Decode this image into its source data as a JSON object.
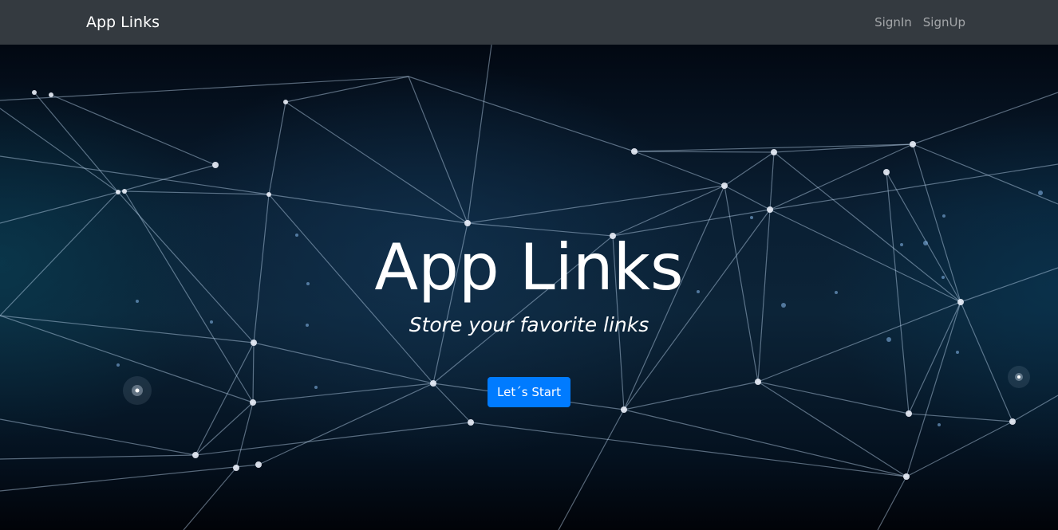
{
  "navbar": {
    "brand": "App Links",
    "links": [
      "SignIn",
      "SignUp"
    ]
  },
  "hero": {
    "title": "App Links",
    "subtitle": "Store your favorite links",
    "button_label": "Let´s Start",
    "background": "plexus-network-image"
  },
  "colors": {
    "navbar_bg": "#343a40",
    "primary": "#007bff",
    "hero_bg": "#0a1f33"
  }
}
